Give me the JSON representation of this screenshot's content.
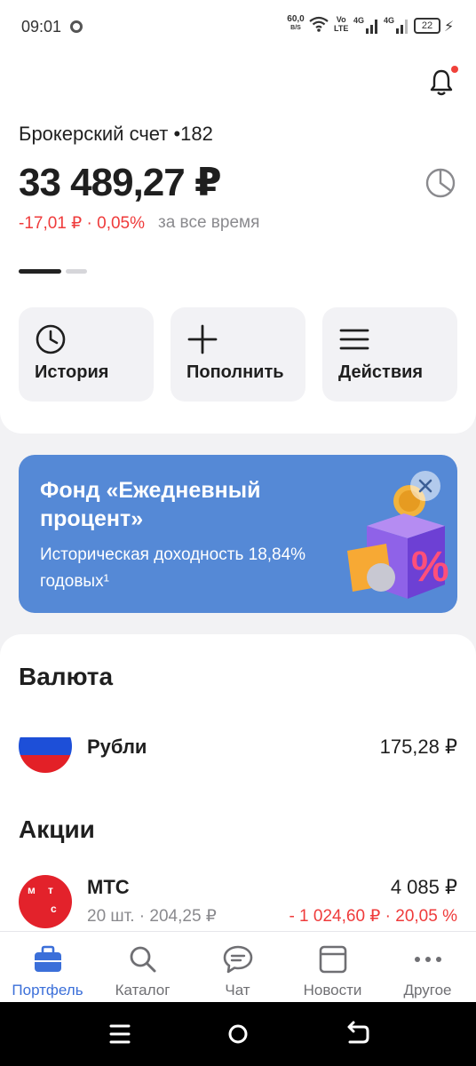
{
  "status_bar": {
    "time": "09:01",
    "net_speed": "60,0",
    "net_speed_unit": "B/S",
    "volte_top": "Vo",
    "volte_bottom": "LTE",
    "sig1_label": "4G",
    "sig2_label": "4G",
    "battery": "22"
  },
  "account": {
    "name": "Брокерский счет •182",
    "total": "33 489,27 ₽",
    "change": "-17,01 ₽ · 0,05%",
    "period": "за все время"
  },
  "quick_actions": [
    {
      "label": "История",
      "icon": "clock-icon"
    },
    {
      "label": "Пополнить",
      "icon": "plus-icon"
    },
    {
      "label": "Действия",
      "icon": "menu-icon"
    }
  ],
  "promo": {
    "title": "Фонд «Ежедневный процент»",
    "subtitle": "Историческая доходность 18,84% годовых¹",
    "art_symbol": "%"
  },
  "sections": {
    "currency": {
      "title": "Валюта",
      "items": [
        {
          "name": "Рубли",
          "value": "175,28 ₽",
          "icon": "russia-flag-icon"
        }
      ]
    },
    "stocks": {
      "title": "Акции",
      "items": [
        {
          "name": "МТС",
          "value": "4 085 ₽",
          "sub": "20 шт. · 204,25 ₽",
          "change": "- 1 024,60 ₽ · 20,05 %",
          "logo_letters": [
            "м",
            "т",
            "с"
          ]
        }
      ]
    }
  },
  "tabs": [
    {
      "label": "Портфель",
      "icon": "briefcase-icon",
      "active": true
    },
    {
      "label": "Каталог",
      "icon": "search-icon",
      "active": false
    },
    {
      "label": "Чат",
      "icon": "chat-icon",
      "active": false
    },
    {
      "label": "Новости",
      "icon": "news-icon",
      "active": false
    },
    {
      "label": "Другое",
      "icon": "more-icon",
      "active": false
    }
  ],
  "colors": {
    "accent": "#3b6fd9",
    "negative": "#ef3b3b",
    "promo_bg": "#5589d6",
    "mts_red": "#e3222b"
  }
}
